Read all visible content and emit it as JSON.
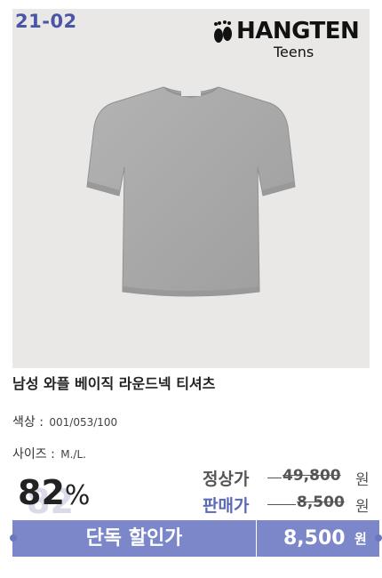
{
  "product": {
    "code": "21-02",
    "brand_name": "HANGTEN",
    "brand_sub": "Teens",
    "title": "남성 와플 베이직 라운드넥 티셔츠",
    "color_label": "색상 :",
    "color_value": "001/053/100",
    "size_label": "사이즈 :",
    "size_value": "M./L.",
    "discount_number": "82",
    "discount_symbol": "%",
    "discount_shadow": "82",
    "regular_label": "정상가",
    "regular_price": "49,800",
    "sale_label": "판매가",
    "sale_price": "8,500",
    "currency": "원",
    "exclusive_label": "단독 할인가",
    "exclusive_price": "8,500",
    "exclusive_currency": "원"
  },
  "colors": {
    "accent": "#7b87c8",
    "code_color": "#4a55a8",
    "sale_label_color": "#5b6ab5",
    "shirt_color": "#a8a8a8",
    "photo_bg": "#e9e8e6"
  },
  "icons": [
    "feet-logo-icon",
    "tshirt-image"
  ]
}
